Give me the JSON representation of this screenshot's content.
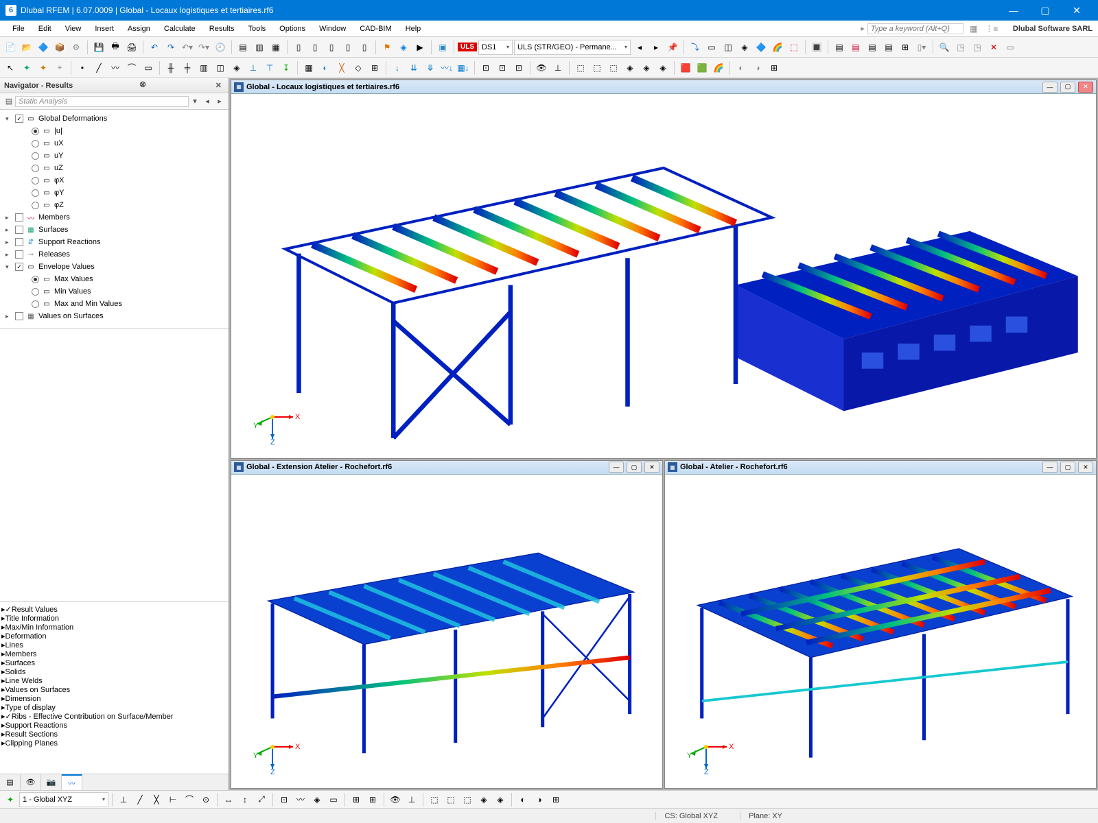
{
  "title": "Dlubal RFEM | 6.07.0009 | Global - Locaux logistiques et tertiaires.rf6",
  "brand": "Dlubal Software SARL",
  "keyword_placeholder": "Type a keyword (Alt+Q)",
  "menu": [
    "File",
    "Edit",
    "View",
    "Insert",
    "Assign",
    "Calculate",
    "Results",
    "Tools",
    "Options",
    "Window",
    "CAD-BIM",
    "Help"
  ],
  "toolbar1": {
    "uls_badge": "ULS",
    "ds_label": "DS1",
    "combo_label": "ULS (STR/GEO) - Permane..."
  },
  "navigator": {
    "title": "Navigator - Results",
    "filter": "Static Analysis",
    "tree": [
      {
        "type": "group",
        "label": "Global Deformations",
        "checked": true,
        "expanded": true,
        "children": [
          {
            "type": "radio",
            "label": "|u|",
            "on": true
          },
          {
            "type": "radio",
            "label": "uX"
          },
          {
            "type": "radio",
            "label": "uY"
          },
          {
            "type": "radio",
            "label": "uZ"
          },
          {
            "type": "radio",
            "label": "φX"
          },
          {
            "type": "radio",
            "label": "φY"
          },
          {
            "type": "radio",
            "label": "φZ"
          }
        ]
      },
      {
        "type": "item",
        "label": "Members",
        "icon": "〰",
        "color": "#c03"
      },
      {
        "type": "item",
        "label": "Surfaces",
        "icon": "▦",
        "color": "#2a7"
      },
      {
        "type": "item",
        "label": "Support Reactions",
        "icon": "⇵",
        "color": "#28d"
      },
      {
        "type": "item",
        "label": "Releases",
        "icon": "⊸",
        "color": "#888"
      },
      {
        "type": "group",
        "label": "Envelope Values",
        "checked": true,
        "expanded": true,
        "children": [
          {
            "type": "radio",
            "label": "Max Values",
            "on": true
          },
          {
            "type": "radio",
            "label": "Min Values"
          },
          {
            "type": "radio",
            "label": "Max and Min Values"
          }
        ]
      },
      {
        "type": "item",
        "label": "Values on Surfaces",
        "icon": "▦",
        "color": "#555"
      }
    ],
    "tree2": [
      {
        "label": "Result Values",
        "checked": true
      },
      {
        "label": "Title Information"
      },
      {
        "label": "Max/Min Information"
      },
      {
        "label": "Deformation"
      },
      {
        "label": "Lines"
      },
      {
        "label": "Members"
      },
      {
        "label": "Surfaces"
      },
      {
        "label": "Solids"
      },
      {
        "label": "Line Welds"
      },
      {
        "label": "Values on Surfaces"
      },
      {
        "label": "Dimension"
      },
      {
        "label": "Type of display"
      },
      {
        "label": "Ribs - Effective Contribution on Surface/Member",
        "checked": true
      },
      {
        "label": "Support Reactions"
      },
      {
        "label": "Result Sections"
      },
      {
        "label": "Clipping Planes",
        "cut": true
      }
    ]
  },
  "views": {
    "main": {
      "title": "Global - Locaux logistiques et tertiaires.rf6",
      "active": false
    },
    "left": {
      "title": "Global - Extension Atelier - Rochefort.rf6"
    },
    "right": {
      "title": "Global - Atelier - Rochefort.rf6"
    }
  },
  "axes": {
    "x": "X",
    "y": "Y",
    "z": "Z"
  },
  "bottombar": {
    "cs_label": "1 - Global XYZ"
  },
  "status": {
    "cs": "CS: Global XYZ",
    "plane": "Plane: XY"
  }
}
